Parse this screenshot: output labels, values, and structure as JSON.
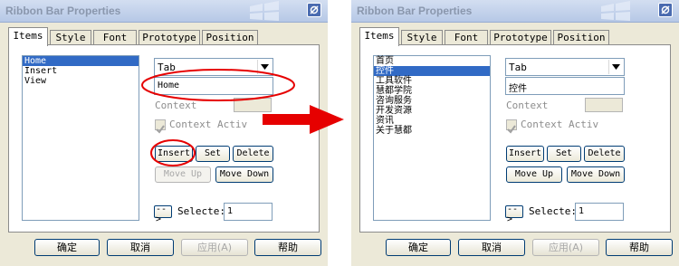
{
  "dialog_title": "Ribbon Bar Properties",
  "tabs": [
    "Items",
    "Style",
    "Font",
    "Prototype",
    "Position"
  ],
  "labels": {
    "context": "Context",
    "context_activ": "Context Activ",
    "selected": "Selecte:",
    "arrow_button": "-->"
  },
  "buttons": {
    "insert": "Insert",
    "set": "Set",
    "delete": "Delete",
    "move_up": "Move Up",
    "move_down": "Move Down"
  },
  "bottom_buttons": {
    "ok": "确定",
    "cancel": "取消",
    "apply": "应用(A)",
    "help": "帮助"
  },
  "left_dialog": {
    "list_items": [
      "Home",
      "Insert",
      "View"
    ],
    "selected_index": 0,
    "type_value": "Tab",
    "caption_value": "Home",
    "selected_value": "1"
  },
  "right_dialog": {
    "list_items": [
      "首页",
      "控件",
      "工具软件",
      "慧都学院",
      "咨询服务",
      "开发资源",
      "资讯",
      "关于慧都"
    ],
    "selected_index": 1,
    "type_value": "Tab",
    "caption_value": "控件",
    "selected_value": "1"
  },
  "colors": {
    "annotation_red": "#e60000",
    "selection_blue": "#316ac5",
    "dialog_bg": "#ece9d8"
  }
}
